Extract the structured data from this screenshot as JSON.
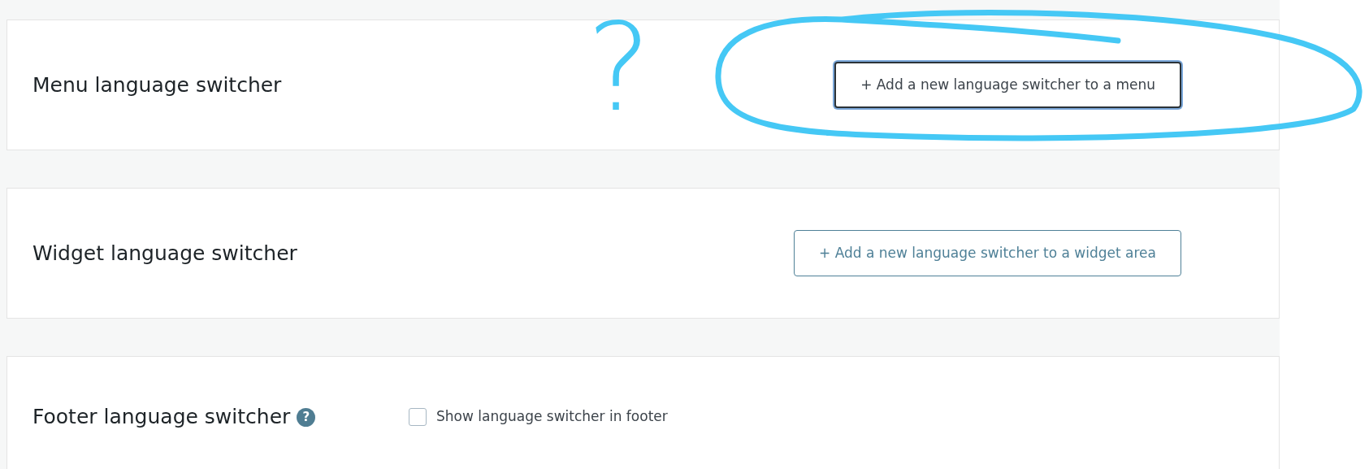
{
  "sections": [
    {
      "kind": "button",
      "title": "Menu language switcher",
      "button": {
        "label": "+ Add a new language switcher to a menu",
        "focused": true
      }
    },
    {
      "kind": "button",
      "title": "Widget language switcher",
      "button": {
        "label": "+ Add a new language switcher to a widget area",
        "focused": false
      }
    },
    {
      "kind": "checkbox",
      "title": "Footer language switcher",
      "help": "?",
      "checkbox": {
        "label": "Show language switcher in footer",
        "checked": false
      }
    }
  ],
  "annotations": [
    {
      "kind": "question",
      "text": "?"
    },
    {
      "kind": "ellipse"
    }
  ]
}
